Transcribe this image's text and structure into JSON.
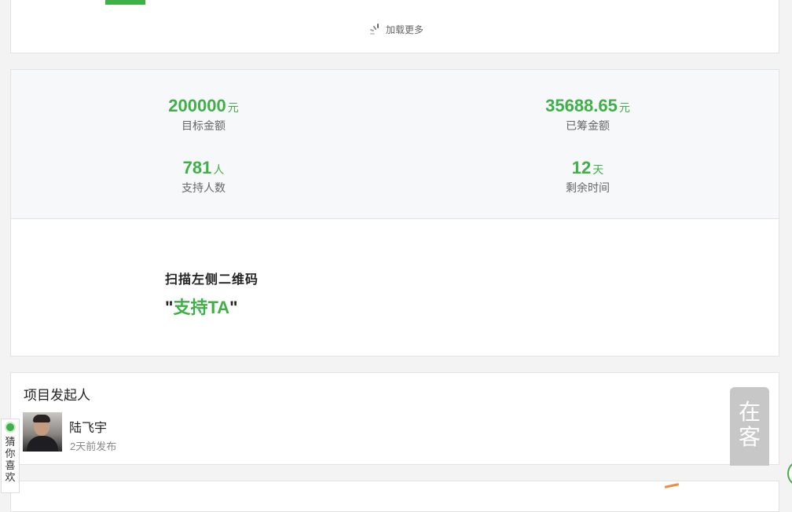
{
  "top_card": {
    "cut_text": "...",
    "load_more_label": "加载更多"
  },
  "stats": {
    "target": {
      "value": "200000",
      "unit": "元",
      "label": "目标金额"
    },
    "raised": {
      "value": "35688.65",
      "unit": "元",
      "label": "已筹金额"
    },
    "supporters": {
      "value": "781",
      "unit": "人",
      "label": "支持人数"
    },
    "remaining": {
      "value": "12",
      "unit": "天",
      "label": "剩余时间"
    }
  },
  "qr": {
    "hint": "扫描左侧二维码",
    "quote_open": "\"",
    "support_text": "支持TA",
    "quote_close": "\""
  },
  "sponsor": {
    "section_title": "项目发起人",
    "name": "陆飞宇",
    "published": "2天前发布"
  },
  "floating": {
    "online_text": "在客",
    "guess_text": "猜你喜欢"
  },
  "colors": {
    "accent_green": "#3faf47",
    "float_gray": "#c7c7c7",
    "orange": "#f08a3e"
  }
}
